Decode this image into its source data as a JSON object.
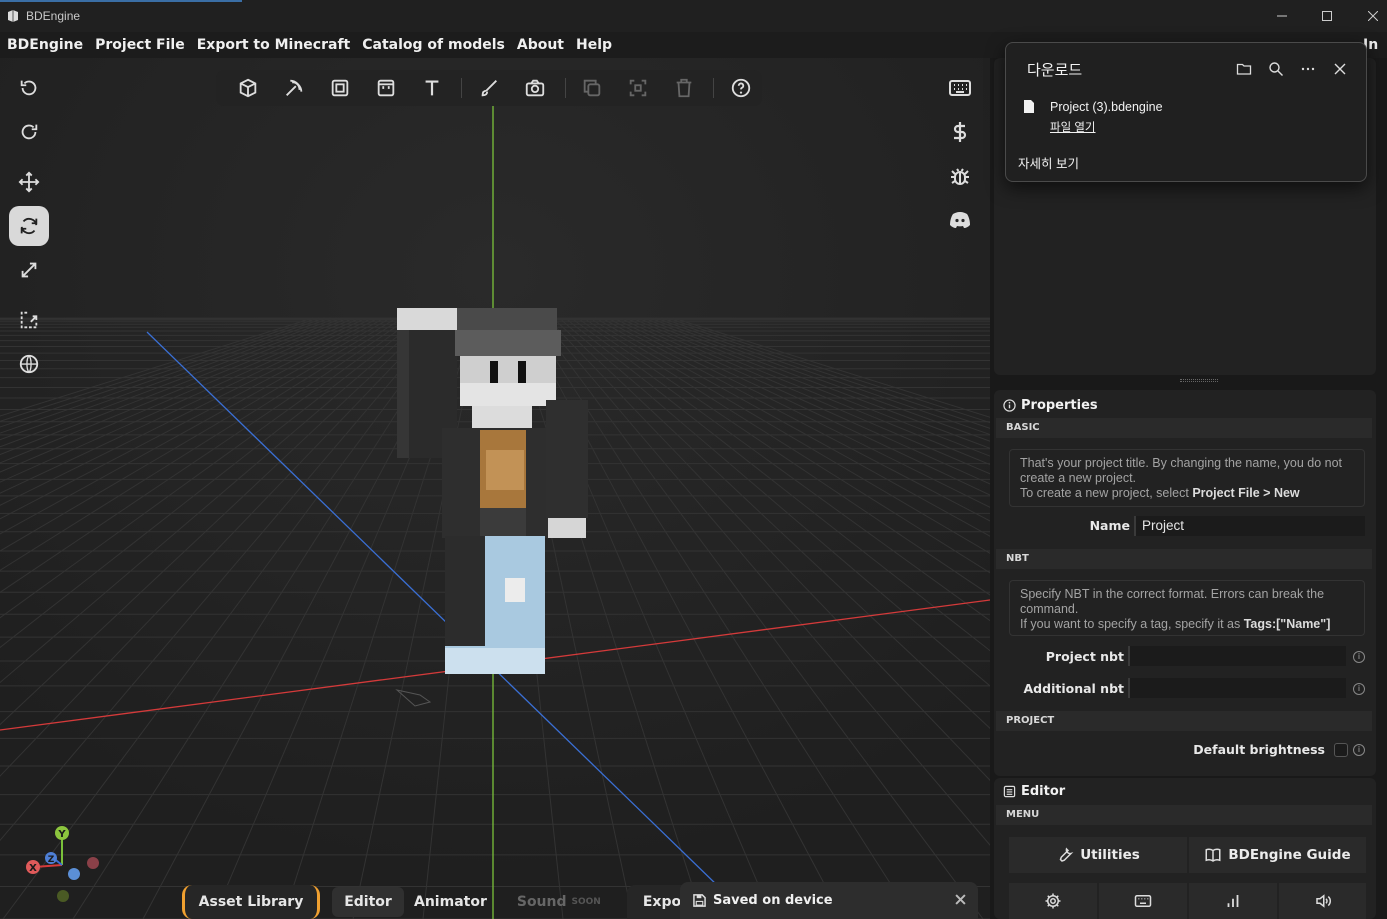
{
  "window": {
    "title": "BDEngine"
  },
  "menu": [
    "BDEngine",
    "Project File",
    "Export to Minecraft",
    "Catalog of models",
    "About",
    "Help"
  ],
  "menu_overflow": "In",
  "left_tools": [
    "undo",
    "redo",
    "move",
    "rotate",
    "scale",
    "pivot",
    "world-space"
  ],
  "active_tool": "rotate",
  "top_tools": [
    "cube",
    "item",
    "block-display",
    "head",
    "text",
    "paint",
    "screenshot",
    "duplicate",
    "select",
    "delete",
    "help"
  ],
  "right_tools": [
    "keyboard",
    "donate",
    "bug-report",
    "discord"
  ],
  "download_popup": {
    "title": "다운로드",
    "file_name": "Project (3).bdengine",
    "open_link": "파일 열기",
    "more_link": "자세히 보기"
  },
  "properties": {
    "title": "Properties",
    "basic_label": "BASIC",
    "basic_note_line1": "That's your project title. By changing the name, you do not create a new project.",
    "basic_note_line2_prefix": "To create a new project, select ",
    "basic_note_line2_bold": "Project File > New",
    "name_label": "Name",
    "name_value": "Project",
    "nbt_label": "NBT",
    "nbt_note_line1": "Specify NBT in the correct format. Errors can break the command.",
    "nbt_note_line2_prefix": "If you want to specify a tag, specify it as ",
    "nbt_note_line2_bold": "Tags:[\"Name\"]",
    "project_nbt_label": "Project nbt",
    "additional_nbt_label": "Additional nbt",
    "project_label": "PROJECT",
    "default_brightness_label": "Default brightness",
    "default_brightness_checked": false
  },
  "editor": {
    "title": "Editor",
    "menu_label": "MENU",
    "utilities_label": "Utilities",
    "guide_label": "BDEngine Guide"
  },
  "bottom_tabs": {
    "asset_library": "Asset Library",
    "editor": "Editor",
    "animator": "Animator",
    "sound": "Sound",
    "sound_badge": "SOON",
    "export": "Expo"
  },
  "toast": {
    "text": "Saved on device"
  },
  "gizmo": {
    "x": "X",
    "y": "Y",
    "z": "Z"
  },
  "colors": {
    "accent_orange": "#f0a030",
    "axis_red": "#d43a3a",
    "axis_green": "#7ac13a",
    "axis_blue": "#3a6fd4"
  }
}
